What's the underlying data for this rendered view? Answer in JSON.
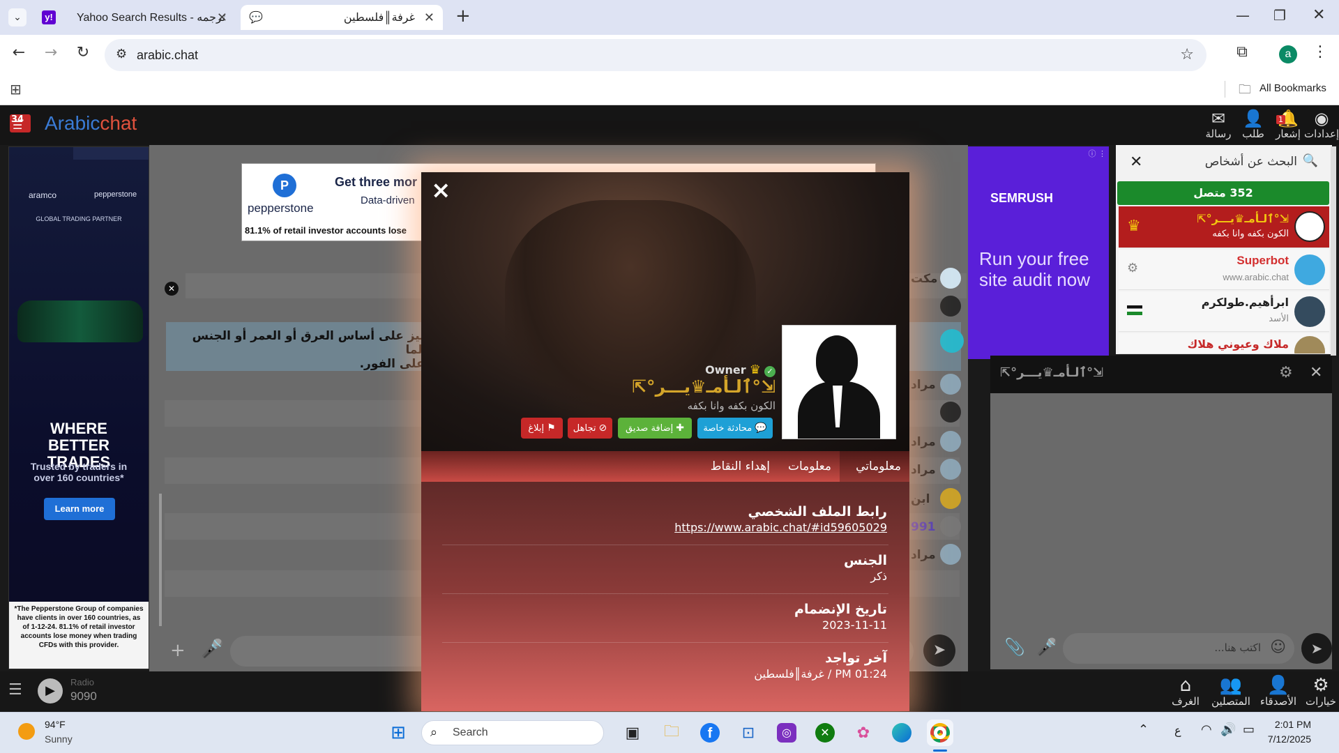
{
  "browser": {
    "tabs": [
      {
        "title": "Yahoo Search Results - ترجمه",
        "favicon": "yahoo-icon"
      },
      {
        "title": "غرفة║فلسطين",
        "favicon": "chat-icon"
      }
    ],
    "new_tab": "+",
    "url": "arabic.chat",
    "bookmarks_label": "All Bookmarks",
    "profile_initial": "a"
  },
  "site": {
    "logo_prefix": "Arabic",
    "logo_suffix": "chat",
    "badge_count": "34",
    "header": {
      "settings": "إعدادات",
      "notifications": "إشعار",
      "notifications_count": "1",
      "requests": "طلب",
      "messages": "رسالة"
    },
    "search_people": "البحث عن أشخاص",
    "online_count": "352 متصل",
    "users": [
      {
        "name": "⇱°ٱلـأمـ♛يـــر°⇲",
        "status": "الكون بكفه وانا بكفه"
      },
      {
        "name": "Superbot",
        "status": "www.arabic.chat"
      },
      {
        "name": "ابرأهيم.طولكرم",
        "status": "الأسد"
      },
      {
        "name": "ملاك وعيوني هلاك",
        "status": ""
      }
    ],
    "pm_title": "⇱°ٱلـأمـ♛يـــر°⇲",
    "pm_placeholder": "اكتب هنا...",
    "chat_notice": "...ييز على أساس العرق أو العمر أو الجنس طالما\n...على الفور.",
    "chat_names": [
      "مكت",
      "مراد",
      "مراد",
      "مراد",
      "ابن",
      "991",
      "مراد"
    ],
    "radio_label": "Radio",
    "radio_number": "9090",
    "bottom_nav": {
      "options": "خيارات",
      "friends": "الأصدقاء",
      "online": "المتصلين",
      "rooms": "الغرف"
    }
  },
  "ads": {
    "left": {
      "brand1": "aramco",
      "brand2": "pepperstone",
      "partner": "GLOBAL TRADING PARTNER",
      "headline": "WHERE BETTER TRADES",
      "sub": "Trusted by traders in over 160 countries*",
      "cta": "Learn more",
      "disclaimer": "*The Pepperstone Group of companies have clients in over 160 countries, as of 1-12-24. 81.1% of retail investor accounts lose money when trading CFDs with this provider."
    },
    "top": {
      "brand": "pepperstone",
      "headline": "Get three mor",
      "sub": "Data-driven",
      "disclaimer": "81.1% of retail investor accounts lose"
    },
    "right": {
      "brand": "SEMRUSH",
      "headline": "Run your free site audit now"
    }
  },
  "profile": {
    "close": "×",
    "role": "Owner",
    "name": "⇱°ٱلـأمـ♛يـــر°⇲",
    "motto": "الكون بكفه وانا بكفه",
    "actions": {
      "private_chat": "محادثة خاصة",
      "add_friend": "إضافة صديق",
      "ignore": "تجاهل",
      "report": "إبلاغ"
    },
    "tabs": [
      "معلوماتي",
      "معلومات",
      "إهداء النقاط"
    ],
    "fields": [
      {
        "label": "رابط الملف الشخصي",
        "value": "https://www.arabic.chat/#id59605029"
      },
      {
        "label": "الجنس",
        "value": "ذكر"
      },
      {
        "label": "تاريخ الإنضمام",
        "value": "2023-11-11"
      },
      {
        "label": "آخر تواجد",
        "value": "01:24 PM / غرفة║فلسطين"
      }
    ]
  },
  "taskbar": {
    "weather_temp": "94°F",
    "weather_desc": "Sunny",
    "search_placeholder": "Search",
    "lang": "ع",
    "time": "2:01 PM",
    "date": "7/12/2025"
  }
}
